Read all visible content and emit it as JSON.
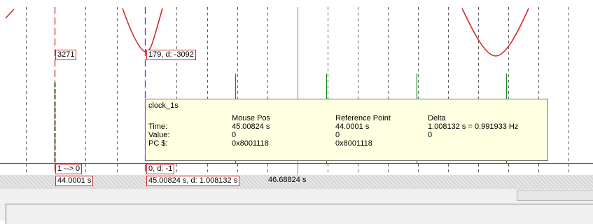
{
  "colors": {
    "signal_green": "#1a8a1a",
    "marker_red": "#d12a2a",
    "marker_blue": "#3f3fd8",
    "grid_dashed": "#606060",
    "tooltip_bg": "#ffffe1"
  },
  "markers": {
    "reference_value": "3271",
    "cursor_value": "179,  d: -3092",
    "reference_transition": "1 --> 0",
    "cursor_transition": "0,  d: -1"
  },
  "timebar": {
    "reference_time": "44.0001 s",
    "cursor_time": "45.00824 s,  d: 1.008132 s",
    "end_time": "46.68824 s"
  },
  "tooltip": {
    "signal": "clock_1s",
    "headers": [
      "",
      "Mouse Pos",
      "Reference Point",
      "Delta"
    ],
    "rows": [
      {
        "label": "Time:",
        "mouse": "45.00824 s",
        "ref": "44.0001 s",
        "delta": "1.008132 s = 0.991933 Hz"
      },
      {
        "label": "Value:",
        "mouse": "0",
        "ref": "0",
        "delta": "0"
      },
      {
        "label": "PC $:",
        "mouse": "0x8001118",
        "ref": "0x8001118",
        "delta": ""
      }
    ]
  }
}
